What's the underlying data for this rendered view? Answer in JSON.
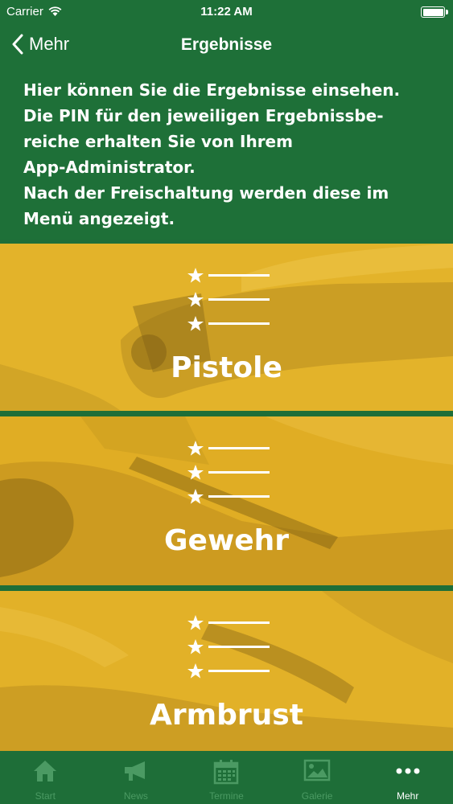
{
  "status_bar": {
    "carrier": "Carrier",
    "time": "11:22 AM"
  },
  "nav": {
    "back_label": "Mehr",
    "title": "Ergebnisse"
  },
  "intro": {
    "lines": [
      "Hier können Sie die Ergebnisse einsehen.",
      "Die PIN für den jeweiligen Ergebnissbe-",
      "reiche erhalten Sie von Ihrem",
      "App-Administrator.",
      "Nach der Freischaltung werden diese im",
      "Menü angezeigt."
    ]
  },
  "categories": [
    {
      "label": "Pistole",
      "icon": "ranking-list-icon"
    },
    {
      "label": "Gewehr",
      "icon": "ranking-list-icon"
    },
    {
      "label": "Armbrust",
      "icon": "ranking-list-icon"
    }
  ],
  "tabs": [
    {
      "label": "Start",
      "icon": "home-icon",
      "active": false
    },
    {
      "label": "News",
      "icon": "megaphone-icon",
      "active": false
    },
    {
      "label": "Termine",
      "icon": "calendar-icon",
      "active": false
    },
    {
      "label": "Galerie",
      "icon": "picture-icon",
      "active": false
    },
    {
      "label": "Mehr",
      "icon": "more-icon",
      "active": true
    }
  ],
  "colors": {
    "primary_green": "#1e7038",
    "tile_yellow": "#e2b227",
    "tab_inactive": "#4b9a63",
    "tab_active": "#ffffff"
  }
}
